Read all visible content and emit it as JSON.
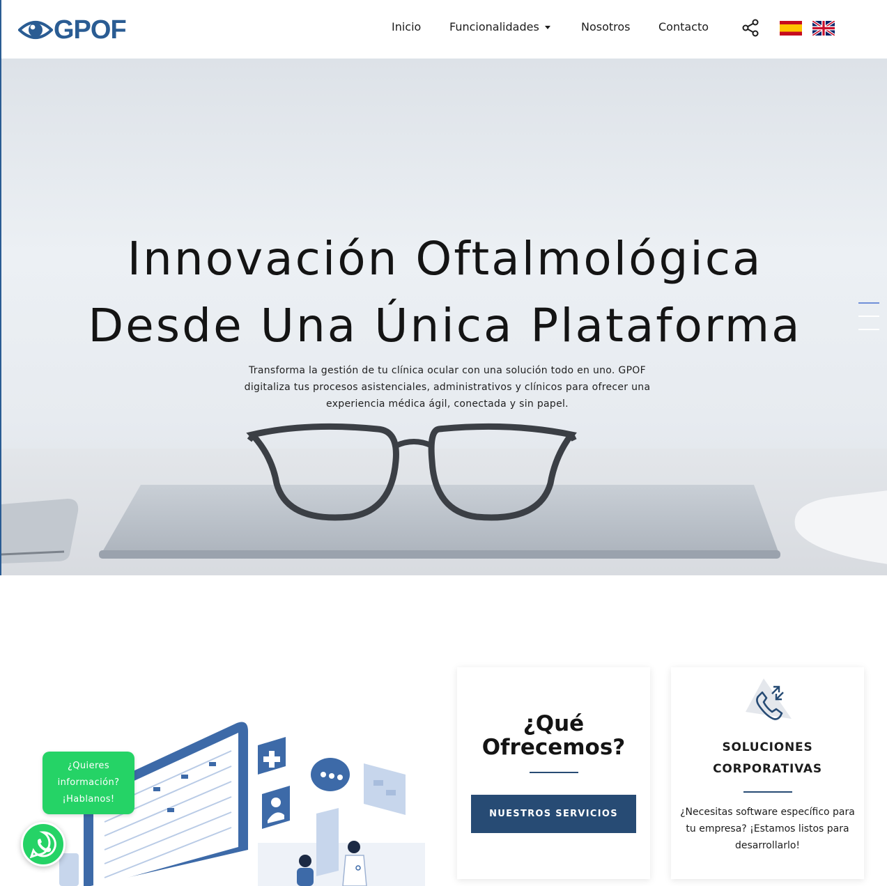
{
  "brand": {
    "name": "GPOF",
    "color": "#2a5c93"
  },
  "nav": {
    "items": [
      {
        "label": "Inicio",
        "has_dropdown": false
      },
      {
        "label": "Funcionalidades",
        "has_dropdown": true
      },
      {
        "label": "Nosotros",
        "has_dropdown": false
      },
      {
        "label": "Contacto",
        "has_dropdown": false
      }
    ],
    "icons": [
      "share-icon",
      "flag-spain",
      "flag-uk"
    ]
  },
  "hero": {
    "title_line1": "Innovación Oftalmológica",
    "title_line2": "Desde Una Única Plataforma",
    "subtitle": "Transforma la gestión de tu clínica ocular con una solución todo en uno. GPOF digitaliza tus procesos asistenciales, administrativos y clínicos para ofrecer una experiencia médica ágil, conectada y sin papel."
  },
  "services": {
    "card1": {
      "title": "¿Qué Ofrecemos?",
      "button": "NUESTROS SERVICIOS"
    },
    "card2": {
      "icon": "phone-transfer-icon",
      "title_line1": "SOLUCIONES",
      "title_line2": "CORPORATIVAS",
      "text": "¿Necesitas software específico para tu empresa? ¡Estamos listos para desarrollarlo!"
    }
  },
  "whatsapp": {
    "line1": "¿Quieres",
    "line2": "información?",
    "line3": "¡Hablanos!",
    "color": "#25d366"
  },
  "colors": {
    "accent": "#274b74",
    "whatsapp": "#25d366"
  }
}
